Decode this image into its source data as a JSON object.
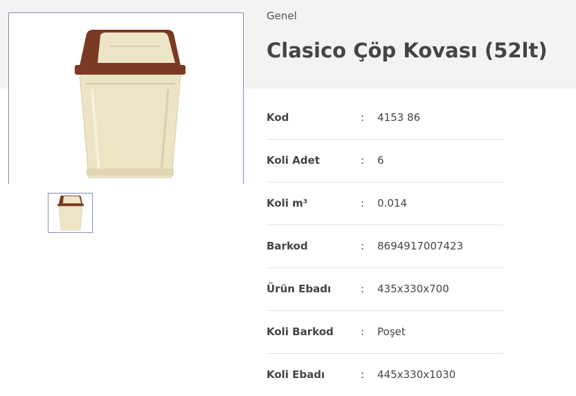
{
  "breadcrumb": "Genel",
  "product": {
    "title": "Clasico Çöp Kovası (52lt)",
    "colors": {
      "lid": "#7a3a24",
      "body": "#ece3c4"
    }
  },
  "specs": [
    {
      "label": "Kod",
      "value": "4153 86"
    },
    {
      "label": "Koli Adet",
      "value": "6"
    },
    {
      "label": "Koli m³",
      "value": "0.014"
    },
    {
      "label": "Barkod",
      "value": "8694917007423"
    },
    {
      "label": "Ürün Ebadı",
      "value": "435x330x700"
    },
    {
      "label": "Koli Barkod",
      "value": "Poşet"
    },
    {
      "label": "Koli Ebadı",
      "value": " 445x330x1030"
    }
  ],
  "separator": ":"
}
